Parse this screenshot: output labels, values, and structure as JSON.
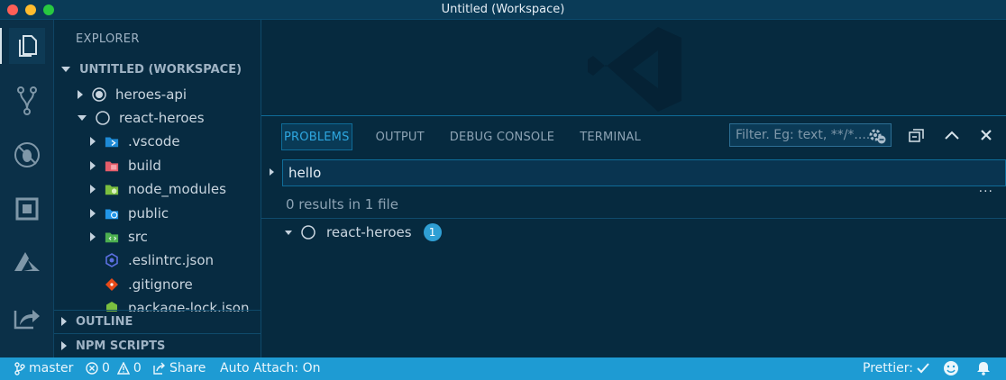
{
  "window": {
    "title": "Untitled (Workspace)"
  },
  "activity_bar": {
    "items": [
      {
        "icon": "files-icon",
        "active": true
      },
      {
        "icon": "source-control-icon",
        "active": false
      },
      {
        "icon": "debug-icon",
        "active": false
      },
      {
        "icon": "extensions-icon",
        "active": false
      },
      {
        "icon": "azure-icon",
        "active": false
      },
      {
        "icon": "live-share-icon",
        "active": false
      }
    ]
  },
  "sidebar": {
    "title": "EXPLORER",
    "workspace_header": "UNTITLED (WORKSPACE)",
    "tree": [
      {
        "label": "heroes-api",
        "icon": "root-folder-icon"
      },
      {
        "label": "react-heroes",
        "icon": "root-folder-open-icon"
      },
      {
        "label": ".vscode",
        "icon": "vscode-folder-icon"
      },
      {
        "label": "build",
        "icon": "build-folder-icon"
      },
      {
        "label": "node_modules",
        "icon": "node-folder-icon"
      },
      {
        "label": "public",
        "icon": "public-folder-icon"
      },
      {
        "label": "src",
        "icon": "src-folder-icon"
      },
      {
        "label": ".eslintrc.json",
        "icon": "eslint-file-icon"
      },
      {
        "label": ".gitignore",
        "icon": "git-file-icon"
      },
      {
        "label": "package-lock.json",
        "icon": "node-file-icon"
      }
    ],
    "outline_header": "OUTLINE",
    "npm_header": "NPM SCRIPTS"
  },
  "panel": {
    "tabs": [
      "PROBLEMS",
      "OUTPUT",
      "DEBUG CONSOLE",
      "TERMINAL"
    ],
    "active_tab": "PROBLEMS",
    "filter_placeholder": "Filter. Eg: text, **/*....",
    "search_value": "hello",
    "summary": "0 results in 1 file",
    "more": "···",
    "result_folder": "react-heroes",
    "result_count": "1"
  },
  "statusbar": {
    "branch": "master",
    "errors": "0",
    "warnings": "0",
    "share": "Share",
    "auto_attach": "Auto Attach: On",
    "prettier": "Prettier:"
  },
  "colors": {
    "background": "#062a3f",
    "accent": "#2ea7e0",
    "statusbar": "#1e9bd3",
    "badge": "#2f9fd4"
  }
}
